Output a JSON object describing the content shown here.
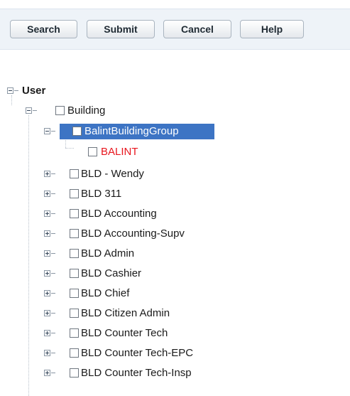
{
  "toolbar": {
    "search_label": "Search",
    "submit_label": "Submit",
    "cancel_label": "Cancel",
    "help_label": "Help"
  },
  "tree": {
    "root": {
      "label": "User",
      "expanded": true
    },
    "building": {
      "label": "Building",
      "expanded": true
    },
    "selected_group": {
      "label": "BalintBuildingGroup",
      "expanded": true,
      "selected": true
    },
    "leaf": {
      "label": "BALINT",
      "color": "#e8161e"
    },
    "groups": [
      {
        "label": "BLD - Wendy"
      },
      {
        "label": "BLD 311"
      },
      {
        "label": "BLD Accounting"
      },
      {
        "label": "BLD Accounting-Supv"
      },
      {
        "label": "BLD Admin"
      },
      {
        "label": "BLD Cashier"
      },
      {
        "label": "BLD Chief"
      },
      {
        "label": "BLD Citizen Admin"
      },
      {
        "label": "BLD Counter Tech"
      },
      {
        "label": "BLD Counter Tech-EPC"
      },
      {
        "label": "BLD Counter Tech-Insp"
      }
    ]
  },
  "colors": {
    "selection": "#3d74c4",
    "toolbar_bg": "#eef3f8",
    "leaf_text": "#e8161e"
  }
}
